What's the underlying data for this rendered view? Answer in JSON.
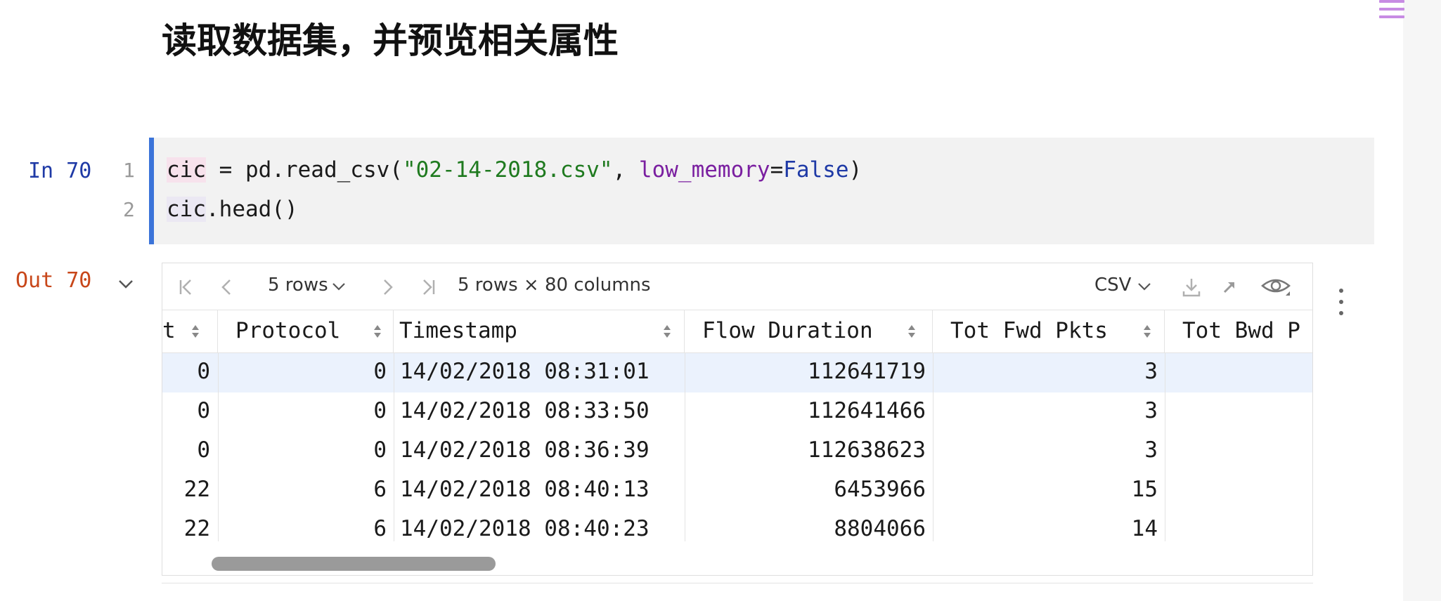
{
  "heading": "读取数据集，并预览相关属性",
  "cell": {
    "in_label": "In 70",
    "out_label": "Out 70",
    "line_numbers": [
      "1",
      "2"
    ],
    "code": {
      "l1_var": "cic",
      "l1_mid": " = pd.read_csv(",
      "l1_str": "\"02-14-2018.csv\"",
      "l1_sep": ", ",
      "l1_kw": "low_memory",
      "l1_eq": "=",
      "l1_val": "False",
      "l1_end": ")",
      "l2_var": "cic",
      "l2_rest": ".head()"
    }
  },
  "toolbar": {
    "rows_select": "5 rows",
    "shape": "5 rows × 80 columns",
    "export_format": "CSV",
    "icons": [
      "first-page-icon",
      "prev-page-icon",
      "next-page-icon",
      "last-page-icon",
      "download-icon",
      "open-external-icon",
      "eye-icon",
      "more-icon"
    ]
  },
  "table": {
    "columns": [
      "t",
      "Protocol",
      "Timestamp",
      "Flow Duration",
      "Tot Fwd Pkts",
      "Tot Bwd P"
    ],
    "rows": [
      [
        "0",
        "0",
        "14/02/2018 08:31:01",
        "112641719",
        "3",
        ""
      ],
      [
        "0",
        "0",
        "14/02/2018 08:33:50",
        "112641466",
        "3",
        ""
      ],
      [
        "0",
        "0",
        "14/02/2018 08:36:39",
        "112638623",
        "3",
        ""
      ],
      [
        "22",
        "6",
        "14/02/2018 08:40:13",
        "6453966",
        "15",
        ""
      ],
      [
        "22",
        "6",
        "14/02/2018 08:40:23",
        "8804066",
        "14",
        ""
      ]
    ]
  },
  "colors": {
    "accent_bar": "#3b74d9",
    "in_label": "#1f3aa6",
    "out_label": "#c8471a",
    "string": "#1f7a1f",
    "keyword_arg": "#7a1fa0",
    "selected_row": "#ebf2fd"
  }
}
